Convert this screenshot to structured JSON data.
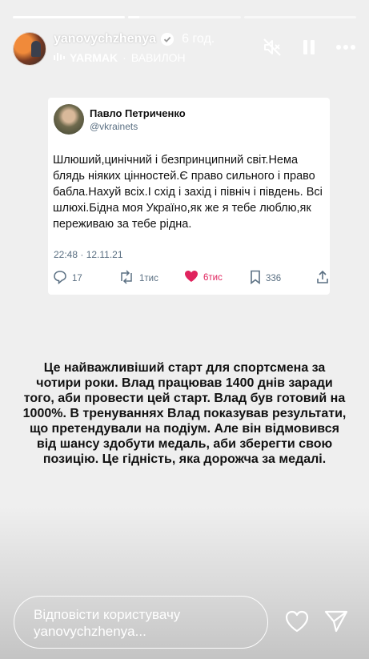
{
  "story": {
    "username": "yanovychzhenya",
    "time_ago": "6 год.",
    "music": {
      "artist": "YARMAK",
      "separator": "·",
      "song": "ВАВИЛОН"
    },
    "progress": [
      1.0,
      0.1,
      0.0
    ]
  },
  "tweet": {
    "author_name": "Павло Петриченко",
    "author_handle": "@vkrainets",
    "text": "Шлюший,цинічний і безпринципний світ.Нема блядь ніяких цінностей.Є право сильного і право бабла.Нахуй всіх.І схід і захід і північ і південь. Всі шлюхі.Бідна моя Україно,як же я тебе люблю,як переживаю за тебе рідна.",
    "datetime": "22:48 · 12.11.21",
    "replies": "17",
    "retweets": "1тис",
    "likes": "6тис",
    "bookmarks": "336",
    "like_color": "#e0245e"
  },
  "caption": "Це найважливіший старт для спортсмена за чотири роки. Влад працював 1400 днів заради того, аби провести цей старт. Влад був готовий на 1000%. В тренуваннях Влад показував результати, що претендували на подіум. Але він відмовився від шансу здобути медаль, аби зберегти свою позицію. Це гідність, яка дорожча за медалі.",
  "reply": {
    "placeholder_line1": "Відповісти користувачу",
    "placeholder_line2": "yanovychzhenya..."
  },
  "icons": [
    "muted-speaker-icon",
    "pause-icon",
    "more-icon",
    "verified-icon",
    "audio-bars-icon",
    "reply-icon",
    "retweet-icon",
    "heart-icon",
    "bookmark-icon",
    "share-icon",
    "like-icon",
    "send-icon"
  ]
}
